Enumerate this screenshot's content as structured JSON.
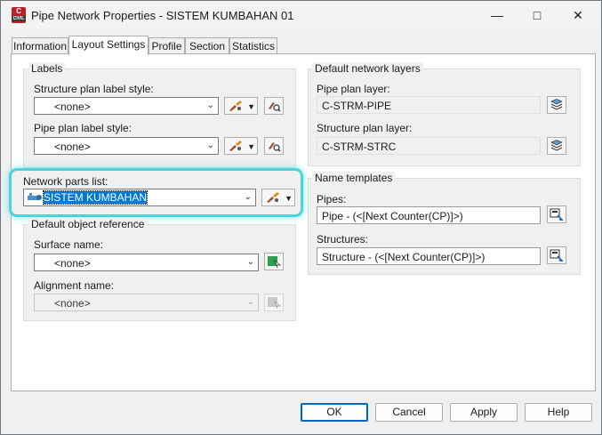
{
  "window": {
    "title": "Pipe Network Properties - SISTEM KUMBAHAN 01",
    "app_icon": "C",
    "app_icon_sub": "CIVIL"
  },
  "tabs": [
    "Information",
    "Layout Settings",
    "Profile",
    "Section",
    "Statistics"
  ],
  "active_tab": "Layout Settings",
  "labels_group": {
    "title": "Labels",
    "structure_plan_label_style": {
      "label": "Structure plan label style:",
      "value": "<none>"
    },
    "pipe_plan_label_style": {
      "label": "Pipe plan label style:",
      "value": "<none>"
    }
  },
  "network_parts_list": {
    "label": "Network parts list:",
    "value": "SISTEM KUMBAHAN"
  },
  "default_object_reference": {
    "title": "Default object reference",
    "surface_name": {
      "label": "Surface name:",
      "value": "<none>"
    },
    "alignment_name": {
      "label": "Alignment name:",
      "value": "<none>"
    }
  },
  "default_network_layers": {
    "title": "Default network layers",
    "pipe_plan_layer": {
      "label": "Pipe plan layer:",
      "value": "C-STRM-PIPE"
    },
    "structure_plan_layer": {
      "label": "Structure plan layer:",
      "value": "C-STRM-STRC"
    }
  },
  "name_templates": {
    "title": "Name templates",
    "pipes": {
      "label": "Pipes:",
      "value": "Pipe - (<[Next Counter(CP)]>)"
    },
    "structures": {
      "label": "Structures:",
      "value": "Structure - (<[Next Counter(CP)]>)"
    }
  },
  "buttons": {
    "ok": "OK",
    "cancel": "Cancel",
    "apply": "Apply",
    "help": "Help"
  },
  "colors": {
    "highlight": "#4fd3d8",
    "selection": "#0078d7",
    "app_icon": "#b3232a"
  }
}
